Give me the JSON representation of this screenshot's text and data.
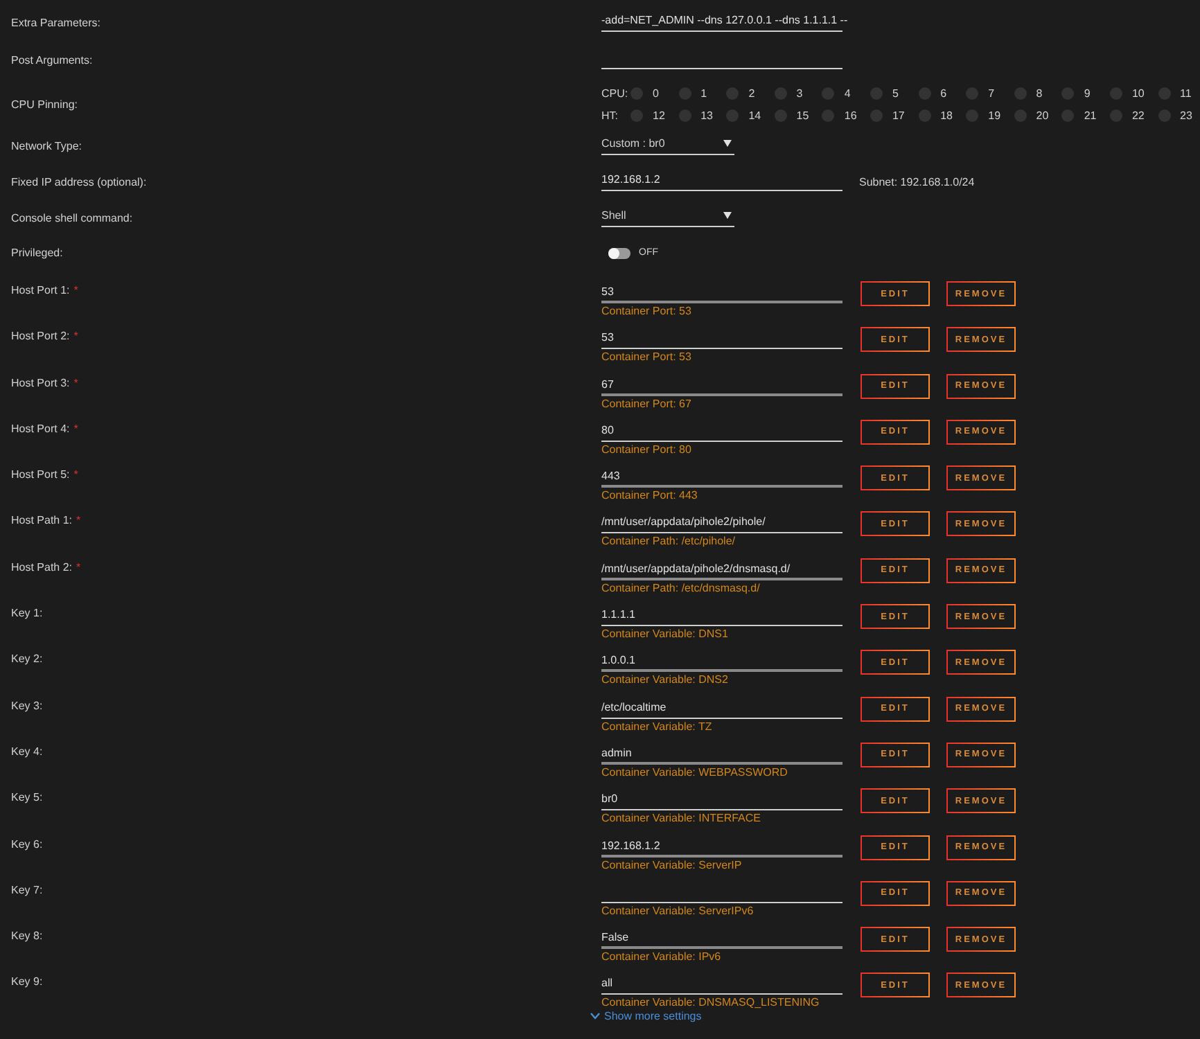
{
  "settings": [
    {
      "kind": "text",
      "label": "Extra Parameters:",
      "value": "-add=NET_ADMIN --dns 127.0.0.1 --dns 1.1.1.1 --"
    },
    {
      "kind": "text",
      "label": "Post Arguments:"
    },
    {
      "kind": "cpu",
      "label": "CPU Pinning:",
      "rows": [
        {
          "label": "CPU:",
          "cores": [
            {
              "num": "0",
              "checked": false
            },
            {
              "num": "1",
              "checked": false
            },
            {
              "num": "2",
              "checked": false
            },
            {
              "num": "3",
              "checked": false
            },
            {
              "num": "4",
              "checked": false
            },
            {
              "num": "5",
              "checked": false
            },
            {
              "num": "6",
              "checked": false
            },
            {
              "num": "7",
              "checked": false
            },
            {
              "num": "8",
              "checked": false
            },
            {
              "num": "9",
              "checked": false
            },
            {
              "num": "10",
              "checked": false
            },
            {
              "num": "11",
              "checked": false
            }
          ]
        },
        {
          "label": "HT:",
          "cores": [
            {
              "num": "12",
              "checked": false
            },
            {
              "num": "13",
              "checked": false
            },
            {
              "num": "14",
              "checked": false
            },
            {
              "num": "15",
              "checked": false
            },
            {
              "num": "16",
              "checked": false
            },
            {
              "num": "17",
              "checked": false
            },
            {
              "num": "18",
              "checked": false
            },
            {
              "num": "19",
              "checked": false
            },
            {
              "num": "20",
              "checked": false
            },
            {
              "num": "21",
              "checked": false
            },
            {
              "num": "22",
              "checked": false
            },
            {
              "num": "23",
              "checked": false
            }
          ]
        }
      ]
    },
    {
      "kind": "select",
      "label": "Network Type:",
      "value": "Custom : br0"
    },
    {
      "kind": "text",
      "label": "Fixed IP address (optional):",
      "value": "192.168.1.2",
      "note": "Subnet: 192.168.1.0/24"
    },
    {
      "kind": "select",
      "label": "Console shell command:",
      "value": "Shell"
    },
    {
      "kind": "toggle",
      "label": "Privileged:",
      "on": false,
      "state_label": "OFF"
    }
  ],
  "mappings": [
    {
      "label": "Host Port 1:",
      "required_mark": "*",
      "value": "53",
      "description": "Container Port: 53",
      "edit": "EDIT",
      "remove": "REMOVE"
    },
    {
      "label": "Host Port 2:",
      "required_mark": "*",
      "value": "53",
      "description": "Container Port: 53",
      "edit": "EDIT",
      "remove": "REMOVE"
    },
    {
      "label": "Host Port 3:",
      "required_mark": "*",
      "value": "67",
      "description": "Container Port: 67",
      "edit": "EDIT",
      "remove": "REMOVE"
    },
    {
      "label": "Host Port 4:",
      "required_mark": "*",
      "value": "80",
      "description": "Container Port: 80",
      "edit": "EDIT",
      "remove": "REMOVE"
    },
    {
      "label": "Host Port 5:",
      "required_mark": "*",
      "value": "443",
      "description": "Container Port: 443",
      "edit": "EDIT",
      "remove": "REMOVE"
    },
    {
      "label": "Host Path 1:",
      "required_mark": "*",
      "value": "/mnt/user/appdata/pihole2/pihole/",
      "description": "Container Path: /etc/pihole/",
      "edit": "EDIT",
      "remove": "REMOVE"
    },
    {
      "label": "Host Path 2:",
      "required_mark": "*",
      "value": "/mnt/user/appdata/pihole2/dnsmasq.d/",
      "description": "Container Path: /etc/dnsmasq.d/",
      "edit": "EDIT",
      "remove": "REMOVE"
    },
    {
      "label": "Key 1:",
      "value": "1.1.1.1",
      "description": "Container Variable: DNS1",
      "edit": "EDIT",
      "remove": "REMOVE"
    },
    {
      "label": "Key 2:",
      "value": "1.0.0.1",
      "description": "Container Variable: DNS2",
      "edit": "EDIT",
      "remove": "REMOVE"
    },
    {
      "label": "Key 3:",
      "value": "/etc/localtime",
      "description": "Container Variable: TZ",
      "edit": "EDIT",
      "remove": "REMOVE"
    },
    {
      "label": "Key 4:",
      "value": "admin",
      "description": "Container Variable: WEBPASSWORD",
      "edit": "EDIT",
      "remove": "REMOVE"
    },
    {
      "label": "Key 5:",
      "value": "br0",
      "description": "Container Variable: INTERFACE",
      "edit": "EDIT",
      "remove": "REMOVE"
    },
    {
      "label": "Key 6:",
      "value": "192.168.1.2",
      "description": "Container Variable: ServerIP",
      "edit": "EDIT",
      "remove": "REMOVE"
    },
    {
      "label": "Key 7:",
      "description": "Container Variable: ServerIPv6",
      "edit": "EDIT",
      "remove": "REMOVE"
    },
    {
      "label": "Key 8:",
      "value": "False",
      "description": "Container Variable: IPv6",
      "edit": "EDIT",
      "remove": "REMOVE"
    },
    {
      "label": "Key 9:",
      "value": "all",
      "description": "Container Variable: DNSMASQ_LISTENING",
      "edit": "EDIT",
      "remove": "REMOVE"
    }
  ],
  "show_more": "Show more settings"
}
